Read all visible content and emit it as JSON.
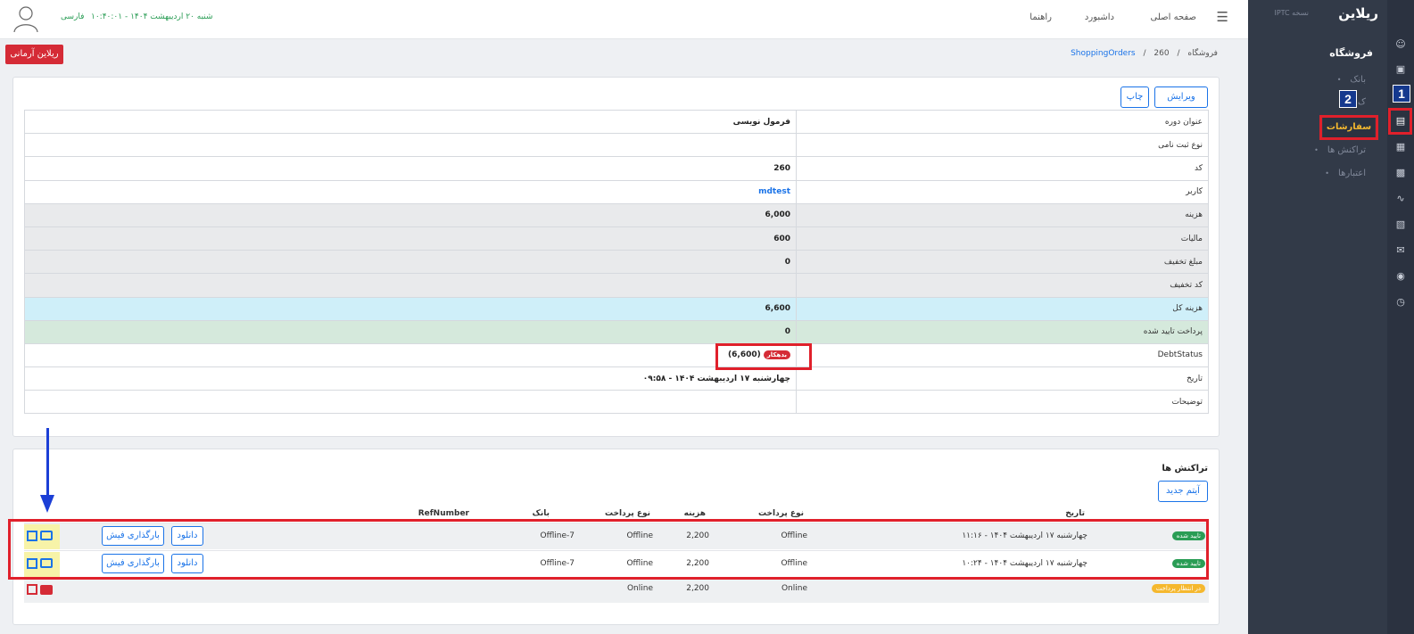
{
  "sidebar": {
    "logo": "ریلاین",
    "logo_sub": "نسخه IPTC",
    "section": "فروشگاه",
    "items": [
      "بانک",
      "ک",
      "سفارشات",
      "تراکنش ها",
      "اعتبارها"
    ],
    "active_item": "سفارشات"
  },
  "badges": {
    "one": "1",
    "two": "2"
  },
  "rail_icons": [
    "users-icon",
    "monitor-icon",
    "basket-icon",
    "list-icon",
    "card-icon",
    "chart-icon",
    "calculator-icon",
    "mail-icon",
    "chat-icon",
    "headset-icon"
  ],
  "topbar": {
    "home": "صفحه اصلی",
    "dashboard": "داشبورد",
    "help": "راهنما",
    "datetime": "شنبه ۲۰ اردیبهشت ۱۴۰۴ - ۱۰:۴۰:۰۱",
    "language": "فارسی"
  },
  "breadcrumb": {
    "root": "فروشگاه",
    "section": "ShoppingOrders",
    "current": "260",
    "sep": "/"
  },
  "brand_button": "ریلاین آرمانی",
  "actions": {
    "edit": "ویرایش",
    "print": "چاپ"
  },
  "details": [
    {
      "label": "عنوان دوره",
      "value": "فرمول نویسی"
    },
    {
      "label": "نوع ثبت نامی",
      "value": ""
    },
    {
      "label": "کد",
      "value": "260"
    },
    {
      "label": "کاربر",
      "value": "mdtest"
    },
    {
      "label": "هزینه",
      "value": "6,000"
    },
    {
      "label": "مالیات",
      "value": "600"
    },
    {
      "label": "مبلغ تخفیف",
      "value": "0"
    },
    {
      "label": "کد تخفیف",
      "value": ""
    },
    {
      "label": "هزینه کل",
      "value": "6,600"
    },
    {
      "label": "پرداخت تایید شده",
      "value": "0"
    },
    {
      "label": "DebtStatus",
      "value": "(6,600)",
      "pill": "بدهکار"
    },
    {
      "label": "تاریخ",
      "value": "چهارشنبه ۱۷ اردیبهشت ۱۴۰۴ - ۰۹:۵۸"
    },
    {
      "label": "توضیحات",
      "value": ""
    }
  ],
  "transactions": {
    "title": "تراکنش ها",
    "new_item": "آیتم جدید",
    "headers": {
      "date": "تاریخ",
      "pay_type": "نوع پرداخت",
      "cost": "هزینه",
      "pay_type2": "نوع پرداخت",
      "bank": "بانک",
      "ref": "RefNumber"
    },
    "upload_label": "بارگذاری فیش",
    "download_label": "دانلود",
    "rows": [
      {
        "status": "تایید شده",
        "date": "چهارشنبه ۱۷ اردیبهشت ۱۴۰۴ - ۱۱:۱۶",
        "type": "Offline",
        "cost": "2,200",
        "type2": "Offline",
        "bank": "Offline-7"
      },
      {
        "status": "تایید شده",
        "date": "چهارشنبه ۱۷ اردیبهشت ۱۴۰۴ - ۱۰:۲۴",
        "type": "Offline",
        "cost": "2,200",
        "type2": "Offline",
        "bank": "Offline-7"
      },
      {
        "status": "در انتظار پرداخت",
        "date": "",
        "type": "Online",
        "cost": "2,200",
        "type2": "Online",
        "bank": ""
      }
    ]
  }
}
